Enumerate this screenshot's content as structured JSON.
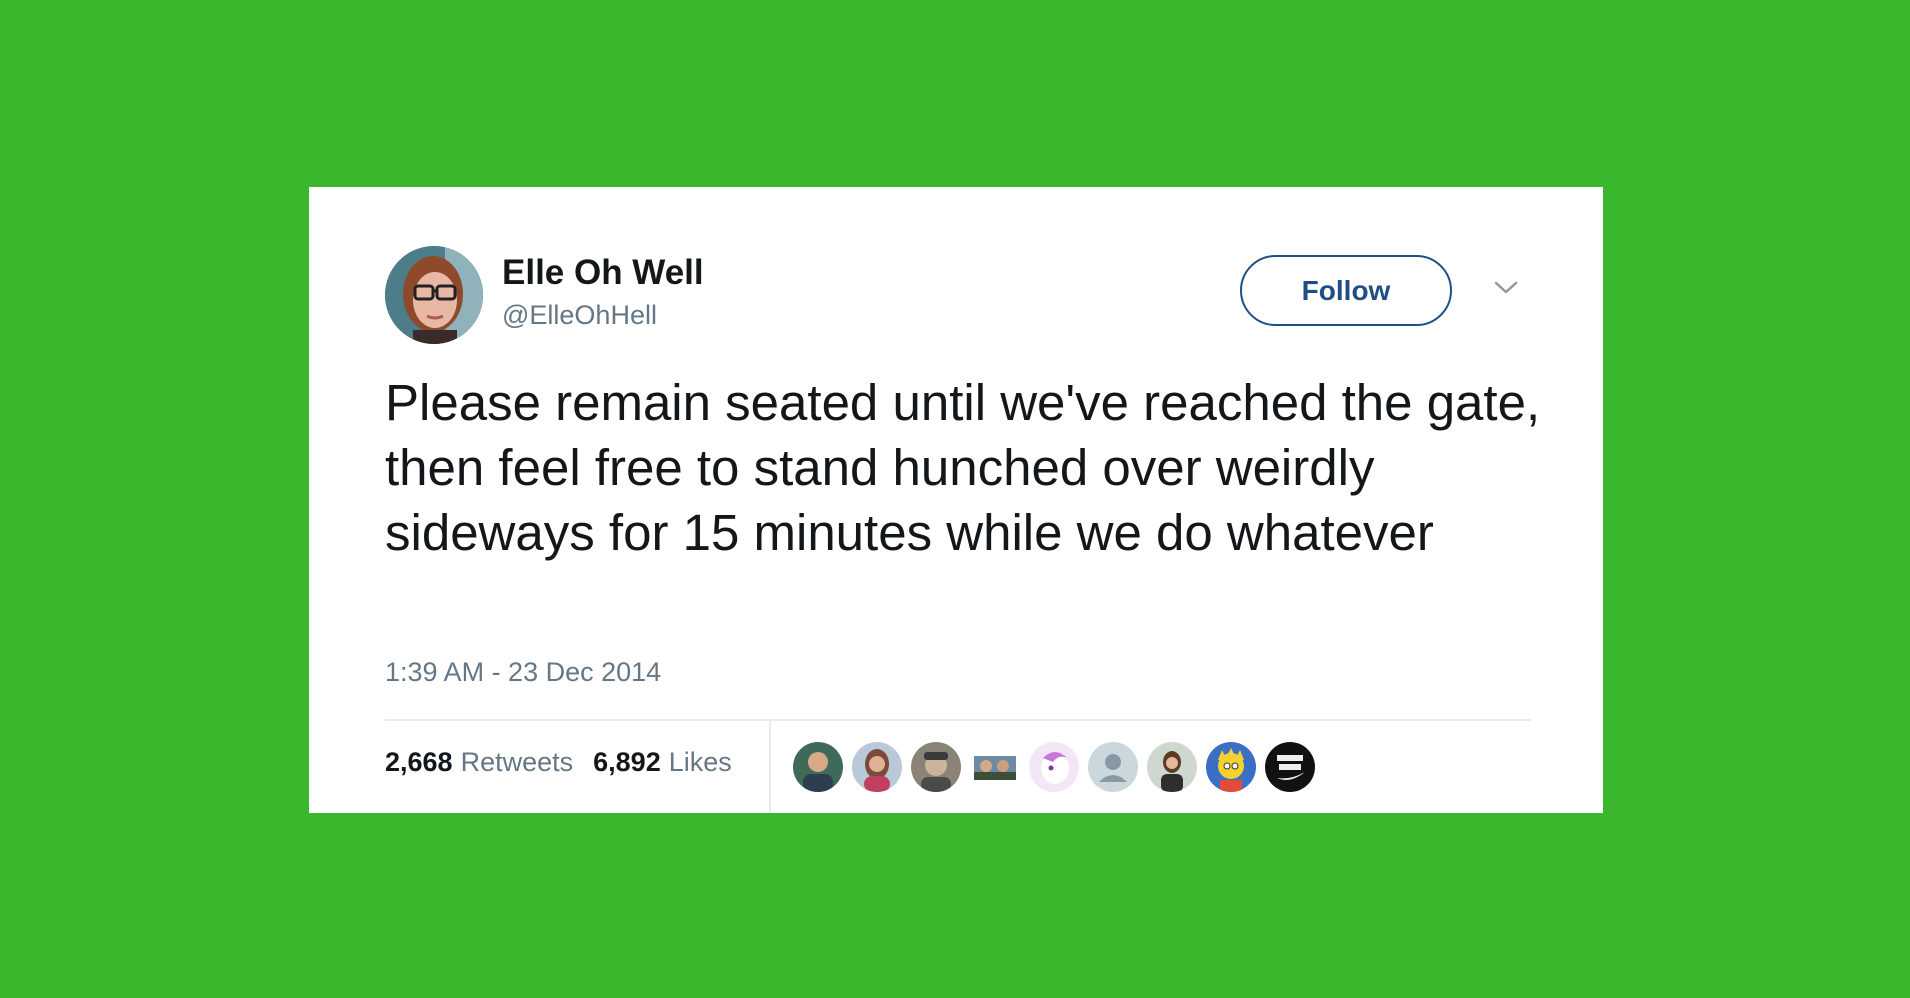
{
  "tweet": {
    "author": {
      "display_name": "Elle Oh Well",
      "handle": "@ElleOhHell",
      "avatar_icon": "profile-photo-woman-glasses"
    },
    "follow_label": "Follow",
    "text": "Please remain seated until we've reached the gate, then feel free to stand hunched over weirdly sideways for 15 minutes while we do whatever",
    "timestamp": "1:39 AM - 23 Dec 2014",
    "stats": {
      "retweets_count": "2,668",
      "retweets_label": "Retweets",
      "likes_count": "6,892",
      "likes_label": "Likes"
    },
    "likers": [
      {
        "icon": "liker-avatar-1"
      },
      {
        "icon": "liker-avatar-2"
      },
      {
        "icon": "liker-avatar-3"
      },
      {
        "icon": "liker-avatar-4"
      },
      {
        "icon": "liker-avatar-5"
      },
      {
        "icon": "default-avatar-icon"
      },
      {
        "icon": "liker-avatar-7"
      },
      {
        "icon": "liker-avatar-8"
      },
      {
        "icon": "liker-avatar-9"
      }
    ]
  },
  "colors": {
    "background": "#3ab72d",
    "card": "#ffffff",
    "text_primary": "#14171a",
    "text_secondary": "#657786",
    "follow_border": "#1d5087",
    "divider": "#e6ecf0"
  }
}
